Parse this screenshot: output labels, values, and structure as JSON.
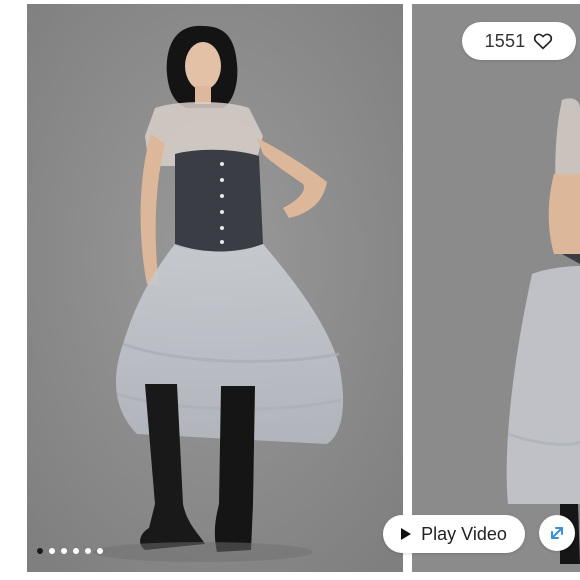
{
  "gallery": {
    "like_count": "1551",
    "like_icon": "heart-outline-icon",
    "play_video_label": "Play Video",
    "play_icon": "play-icon",
    "expand_icon": "expand-arrows-icon",
    "slide_count": 6,
    "active_slide": 1
  },
  "colors": {
    "backdrop": "#8e8e8e",
    "accent_blue": "#3a8fd9"
  }
}
